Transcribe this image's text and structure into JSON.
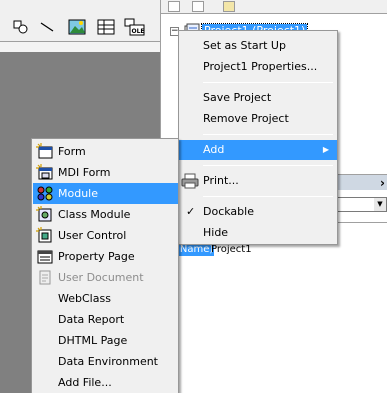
{
  "toolbox": {
    "icons": [
      "shapes-icon",
      "line-icon",
      "image-icon",
      "grid-icon",
      "ole-icon"
    ]
  },
  "project_explorer": {
    "toolbar_icons": [
      "view-code-icon",
      "view-object-icon",
      "toggle-folders-icon"
    ],
    "tree_root": "Project1 (Project1)"
  },
  "properties": {
    "name_key": "(Name)",
    "name_value": "Project1"
  },
  "context_menu": {
    "items": [
      {
        "label": "Set as Start Up"
      },
      {
        "label": "Project1 Properties..."
      },
      {
        "label": "Save Project"
      },
      {
        "label": "Remove Project"
      },
      {
        "label": "Add",
        "highlighted": true,
        "has_submenu": true
      },
      {
        "label": "Print...",
        "icon": "printer-icon"
      },
      {
        "label": "Dockable",
        "checked": true
      },
      {
        "label": "Hide"
      }
    ]
  },
  "add_submenu": {
    "items": [
      {
        "label": "Form",
        "icon": "form-icon"
      },
      {
        "label": "MDI Form",
        "icon": "mdi-form-icon"
      },
      {
        "label": "Module",
        "icon": "module-icon",
        "highlighted": true
      },
      {
        "label": "Class Module",
        "icon": "class-module-icon"
      },
      {
        "label": "User Control",
        "icon": "user-control-icon"
      },
      {
        "label": "Property Page",
        "icon": "property-page-icon"
      },
      {
        "label": "User Document",
        "icon": "user-document-icon",
        "disabled": true
      },
      {
        "label": "WebClass"
      },
      {
        "label": "Data Report"
      },
      {
        "label": "DHTML Page"
      },
      {
        "label": "Data Environment"
      },
      {
        "label": "Add File..."
      }
    ]
  },
  "colors": {
    "highlight": "#3399ff",
    "menu_bg": "#f0f0f0",
    "workspace_gray": "#808080"
  }
}
